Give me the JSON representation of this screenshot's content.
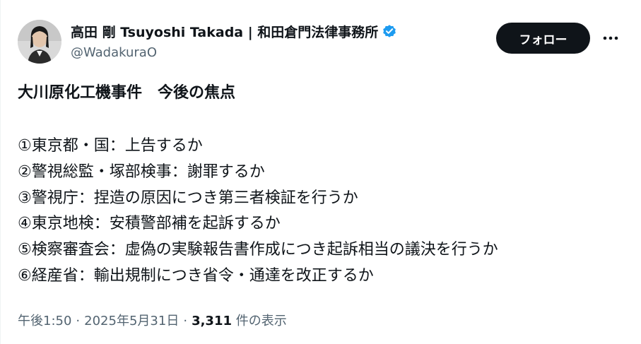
{
  "author": {
    "display_name": "高田 剛 Tsuyoshi Takada | 和田倉門法律事務所",
    "handle": "@WadakuraO",
    "verified_icon": "verified-badge-icon"
  },
  "actions": {
    "follow_label": "フォロー",
    "more_icon": "more-icon"
  },
  "tweet": {
    "title": "大川原化工機事件　今後の焦点",
    "items": [
      "①東京都・国：上告するか",
      "②警視総監・塚部検事：謝罪するか",
      "③警視庁：捏造の原因につき第三者検証を行うか",
      "④東京地検：安積警部補を起訴するか",
      "⑤検察審査会：虚偽の実験報告書作成につき起訴相当の議決を行うか",
      "⑥経産省：輸出規制につき省令・通達を改正するか"
    ]
  },
  "meta": {
    "time": "午後1:50",
    "separator": "·",
    "date": "2025年5月31日",
    "views_count": "3,311",
    "views_label": "件の表示"
  },
  "colors": {
    "text": "#0f1419",
    "secondary": "#536471",
    "verified": "#1d9bf0",
    "follow_bg": "#0f1419"
  }
}
